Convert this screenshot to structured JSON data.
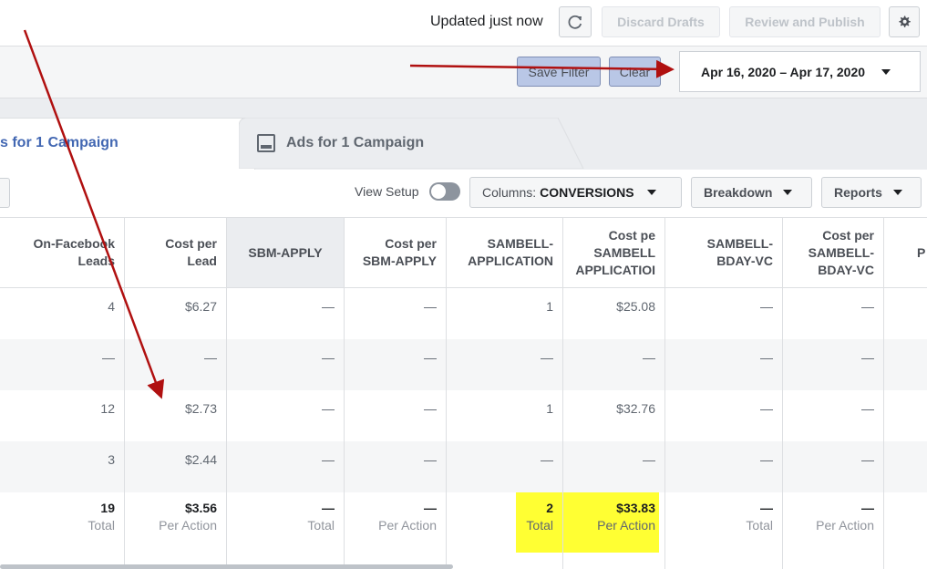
{
  "header": {
    "updated_text": "Updated just now",
    "discard_label": "Discard Drafts",
    "review_label": "Review and Publish"
  },
  "filter_bar": {
    "save_filter_label": "Save Filter",
    "clear_label": "Clear",
    "date_range": "Apr 16, 2020 – Apr 17, 2020"
  },
  "tabs": {
    "active_label": "s for 1 Campaign",
    "ads_label": "Ads for 1 Campaign"
  },
  "toolbar": {
    "view_setup_label": "View Setup",
    "columns_prefix": "Columns:",
    "columns_value": "CONVERSIONS",
    "breakdown_label": "Breakdown",
    "reports_label": "Reports"
  },
  "table": {
    "columns": [
      "On-Facebook\nLeads",
      "Cost per\nLead",
      "SBM-APPLY",
      "Cost per\nSBM-APPLY",
      "SAMBELL-\nAPPLICATION",
      "Cost pe\nSAMBELL\nAPPLICATIOI",
      "SAMBELL-\nBDAY-VC",
      "Cost per\nSAMBELL-\nBDAY-VC",
      "P"
    ],
    "rows": [
      [
        "4",
        "$6.27",
        "—",
        "—",
        "1",
        "$25.08",
        "—",
        "—"
      ],
      [
        "—",
        "—",
        "—",
        "—",
        "—",
        "—",
        "—",
        "—"
      ],
      [
        "12",
        "$2.73",
        "—",
        "—",
        "1",
        "$32.76",
        "—",
        "—"
      ],
      [
        "3",
        "$2.44",
        "—",
        "—",
        "—",
        "—",
        "—",
        "—"
      ]
    ],
    "totals": [
      {
        "value": "19",
        "label": "Total"
      },
      {
        "value": "$3.56",
        "label": "Per Action"
      },
      {
        "value": "—",
        "label": "Total"
      },
      {
        "value": "—",
        "label": "Per Action"
      },
      {
        "value": "2",
        "label": "Total"
      },
      {
        "value": "$33.83",
        "label": "Per Action"
      },
      {
        "value": "—",
        "label": "Total"
      },
      {
        "value": "—",
        "label": "Per Action"
      }
    ]
  },
  "colors": {
    "annotation_arrow": "#b01010",
    "highlight": "#ffff33",
    "link_blue": "#4267b2"
  }
}
